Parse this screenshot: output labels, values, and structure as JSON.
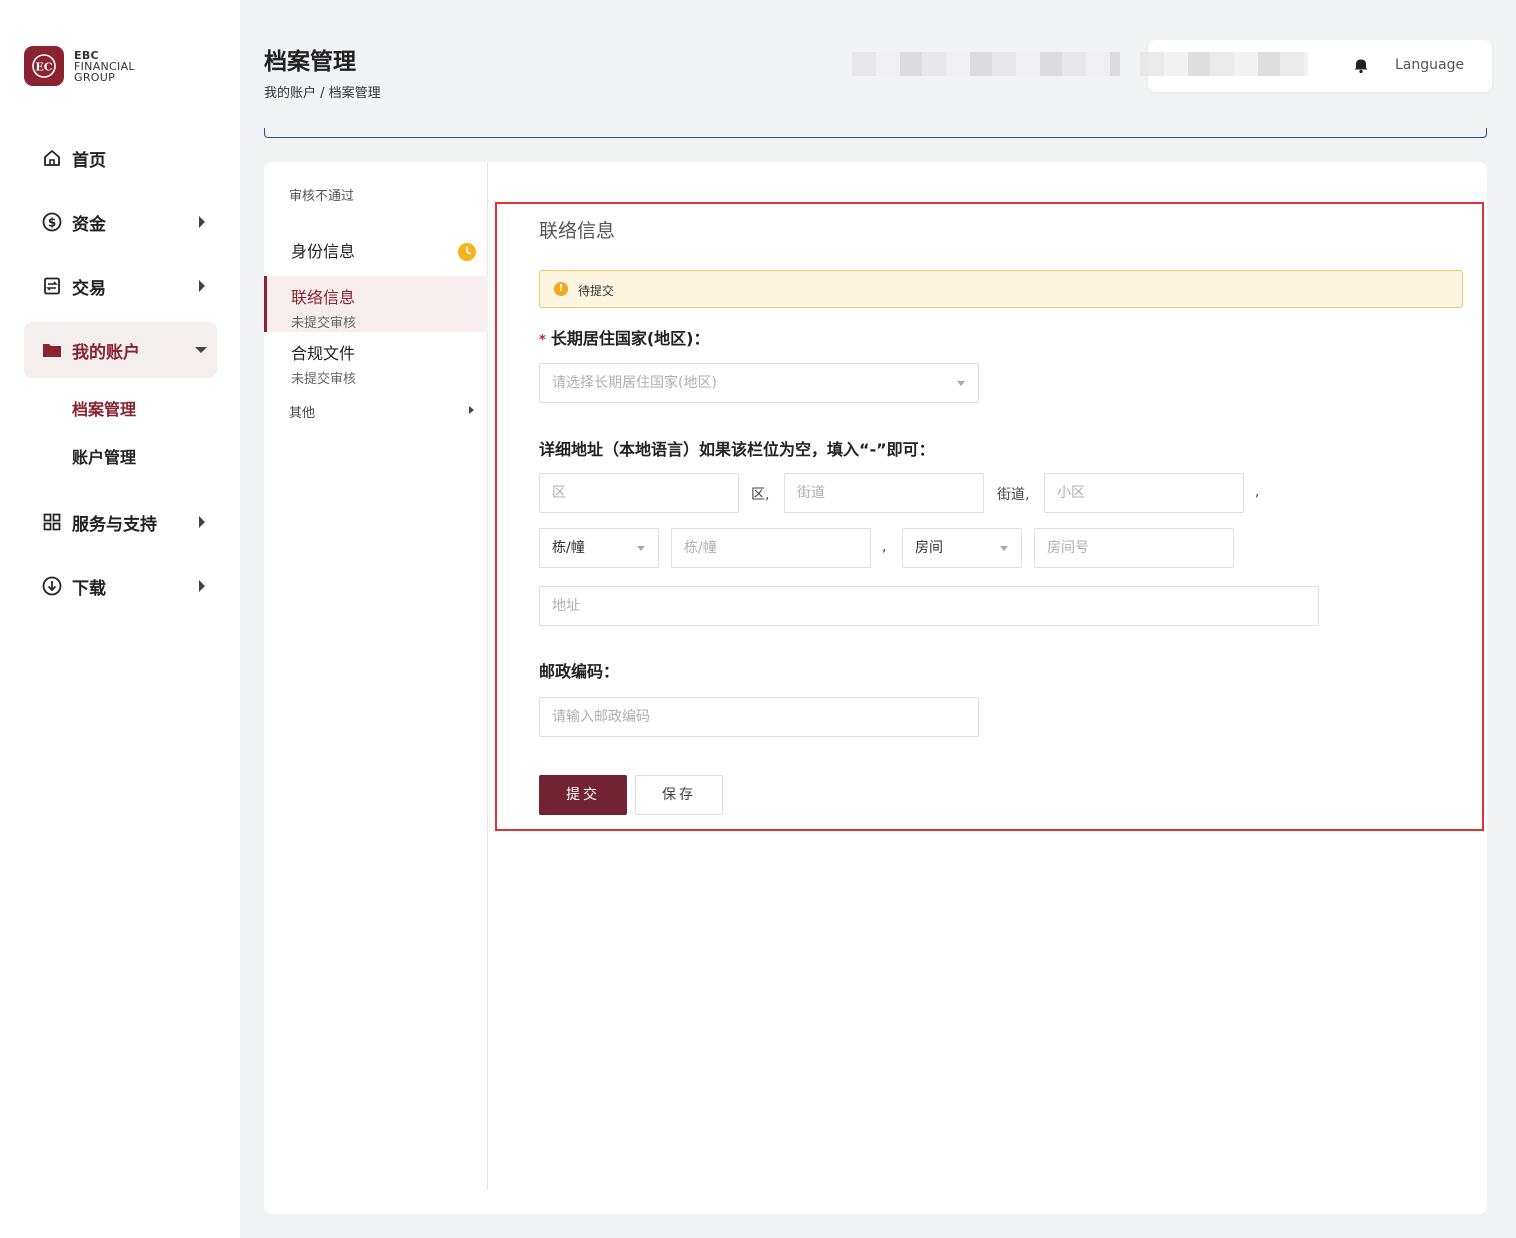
{
  "brand": {
    "line1": "EBC",
    "line2": "FINANCIAL",
    "line3": "GROUP"
  },
  "nav": {
    "home": "首页",
    "funds": "资金",
    "trade": "交易",
    "my_account": "我的账户",
    "sub_profile": "档案管理",
    "sub_account": "账户管理",
    "service": "服务与支持",
    "download": "下载"
  },
  "header": {
    "title": "档案管理",
    "breadcrumb": "我的账户 / 档案管理",
    "language": "Language"
  },
  "left_panel": {
    "status": "审核不通过",
    "items": [
      {
        "title": "身份信息",
        "sub": ""
      },
      {
        "title": "联络信息",
        "sub": "未提交审核"
      },
      {
        "title": "合规文件",
        "sub": "未提交审核"
      }
    ],
    "other": "其他"
  },
  "form": {
    "section_title": "联络信息",
    "alert": "待提交",
    "country_label": "长期居住国家(地区)：",
    "country_placeholder": "请选择长期居住国家(地区)",
    "address_label": "详细地址（本地语言）如果该栏位为空，填入“-”即可：",
    "district_placeholder": "区",
    "district_suffix": "区,",
    "street_placeholder": "街道",
    "street_suffix": "街道,",
    "community_placeholder": "小区",
    "community_suffix": ",",
    "building_select": "栋/幢",
    "building_placeholder": "栋/幢",
    "building_suffix": ",",
    "room_select": "房间",
    "room_placeholder": "房间号",
    "address_placeholder": "地址",
    "postal_label": "邮政编码：",
    "postal_placeholder": "请输入邮政编码",
    "submit": "提交",
    "save": "保存"
  },
  "colors": {
    "brand": "#8a2230",
    "primary_button": "#722434",
    "alert_bg": "#fef5e0",
    "highlight": "#e0303a"
  }
}
